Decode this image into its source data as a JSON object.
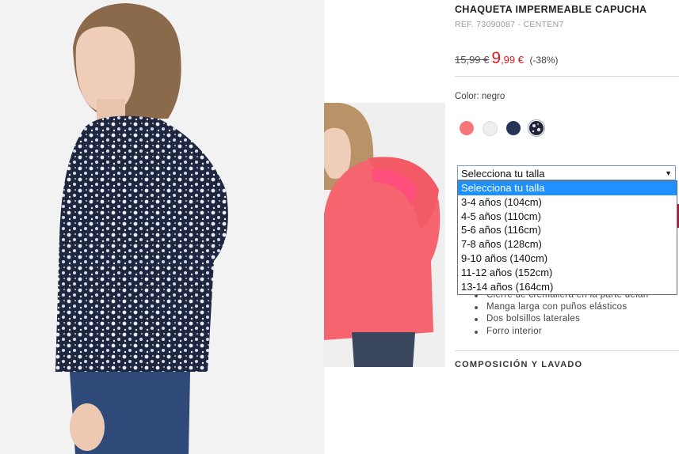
{
  "product": {
    "title": "CHAQUETA IMPERMEABLE CAPUCHA",
    "ref": "REF. 73090087 - CENTEN7",
    "old_price": "15,99 €",
    "new_price_int": "9",
    "new_price_dec": ",99 €",
    "discount": "(-38%)",
    "color_label": "Color: negro"
  },
  "swatches": [
    {
      "name": "rosa",
      "color": "#f7767a"
    },
    {
      "name": "blanco",
      "color": "#eeeeee"
    },
    {
      "name": "azul marino",
      "color": "#263456"
    },
    {
      "name": "estampado negro",
      "color": "#20233a"
    }
  ],
  "size_select": {
    "value": "Selecciona tu talla",
    "options": [
      "Selecciona tu talla",
      "3-4 años (104cm)",
      "4-5 años (110cm)",
      "5-6 años (116cm)",
      "7-8 años (128cm)",
      "9-10 años (140cm)",
      "11-12 años (152cm)",
      "13-14 años (164cm)"
    ]
  },
  "features": [
    "Cierre de cremallera en la parte delan",
    "Manga larga con puños elásticos",
    "Dos bolsillos laterales",
    "Forro interior"
  ],
  "sections": {
    "composition": "COMPOSICIÓN Y LAVADO"
  }
}
